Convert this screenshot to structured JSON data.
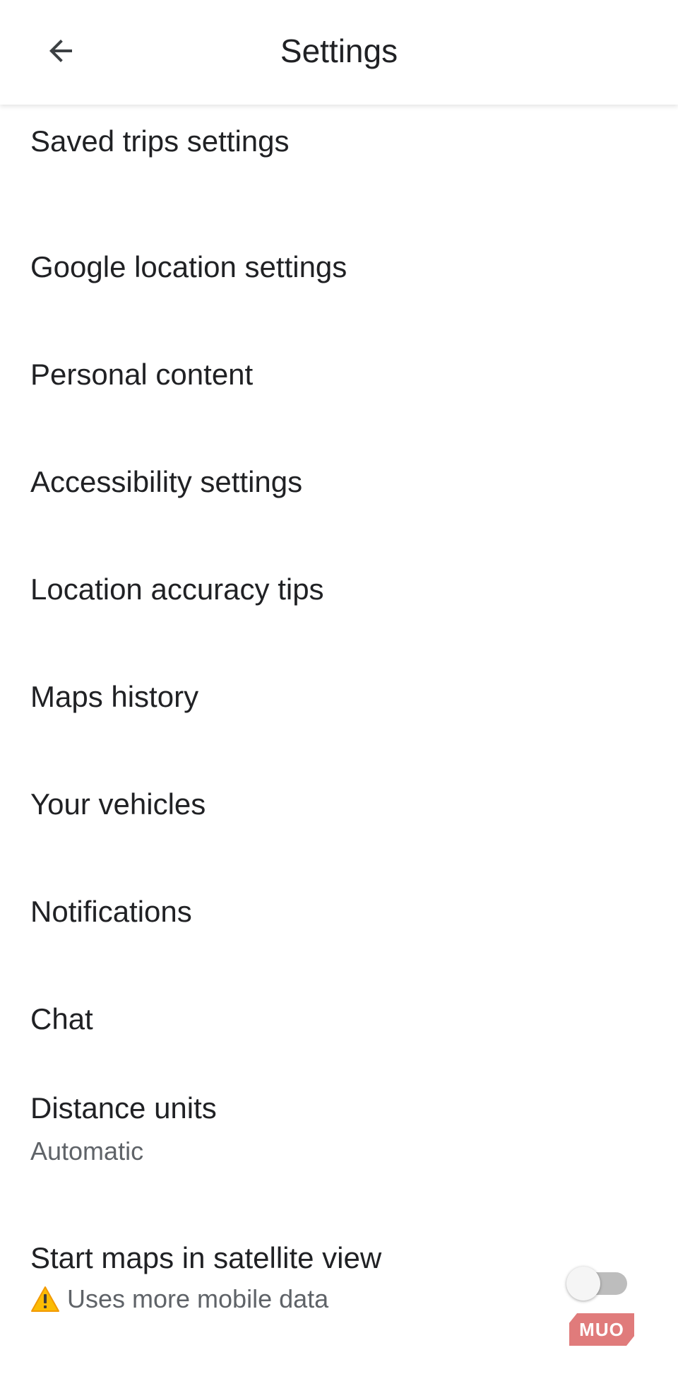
{
  "header": {
    "title": "Settings",
    "back_icon": "arrow-back-icon"
  },
  "settings_items": [
    {
      "label": "Saved trips settings"
    },
    {
      "label": "Google location settings"
    },
    {
      "label": "Personal content"
    },
    {
      "label": "Accessibility settings"
    },
    {
      "label": "Location accuracy tips"
    },
    {
      "label": "Maps history"
    },
    {
      "label": "Your vehicles"
    },
    {
      "label": "Notifications"
    },
    {
      "label": "Chat"
    }
  ],
  "distance_units": {
    "label": "Distance units",
    "value": "Automatic"
  },
  "satellite_view": {
    "label": "Start maps in satellite view",
    "warning_icon": "warning-icon",
    "warning_text": "Uses more mobile data",
    "enabled": false
  },
  "watermark": {
    "text": "MUO"
  },
  "colors": {
    "background": "#ffffff",
    "text_primary": "#202124",
    "text_secondary": "#5f6368",
    "warning": "#fbbc04",
    "watermark": "#e07b7b"
  }
}
